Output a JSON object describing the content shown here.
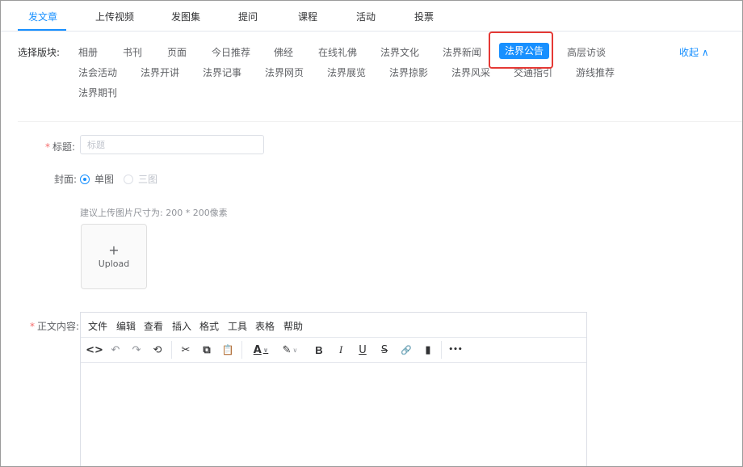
{
  "tabs": [
    {
      "label": "发文章",
      "active": true
    },
    {
      "label": "上传视频"
    },
    {
      "label": "发图集"
    },
    {
      "label": "提问"
    },
    {
      "label": "课程"
    },
    {
      "label": "活动"
    },
    {
      "label": "投票"
    }
  ],
  "sections": {
    "label": "选择版块:",
    "collapse_label": "收起 ∧",
    "selected": "法界公告",
    "items": [
      "相册",
      "书刊",
      "页面",
      "今日推荐",
      "佛经",
      "在线礼佛",
      "法界文化",
      "法界新闻",
      "法界公告",
      "高层访谈",
      "法会活动",
      "法界开讲",
      "法界记事",
      "法界网页",
      "法界展览",
      "法界掠影",
      "法界风采",
      "交通指引",
      "游线推荐",
      "法界期刊"
    ]
  },
  "form": {
    "title": {
      "required": "*",
      "label": "标题:",
      "value": "",
      "placeholder": "标题"
    },
    "cover": {
      "label": "封面:",
      "options": [
        {
          "label": "单图",
          "checked": true
        },
        {
          "label": "三图",
          "checked": false
        }
      ]
    },
    "upload_hint": "建议上传图片尺寸为: 200 * 200像素",
    "upload": {
      "plus": "+",
      "label": "Upload"
    },
    "content": {
      "required": "*",
      "label": "正文内容:"
    }
  },
  "editor": {
    "menus": [
      "文件",
      "编辑",
      "查看",
      "插入",
      "格式",
      "工具",
      "表格",
      "帮助"
    ],
    "toolbar": {
      "code": "<>",
      "undo": "↶",
      "redo": "↷",
      "history": "⟲",
      "cut": "✂",
      "copy": "⧉",
      "paste": "📋",
      "font_color": "A",
      "highlight": "✎",
      "bold": "B",
      "italic": "I",
      "underline": "U",
      "strike": "S",
      "link": "🔗",
      "bookmark": "▮",
      "more": "•••"
    }
  },
  "colors": {
    "accent": "#1890ff",
    "required": "#f56c6c",
    "highlight_box": "#e53935"
  }
}
